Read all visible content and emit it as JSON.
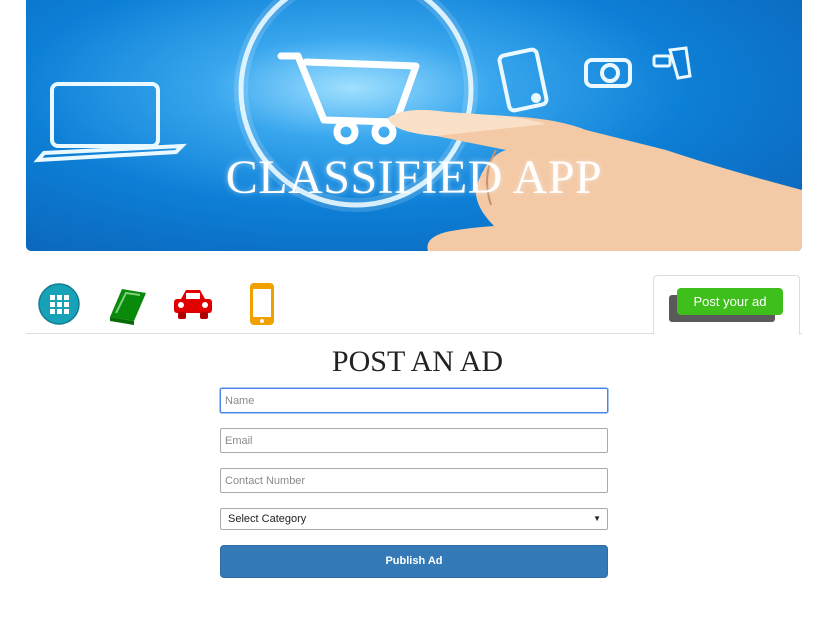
{
  "banner": {
    "title": "CLASSIFIED APP"
  },
  "nav": {
    "icons": [
      {
        "name": "grid-icon",
        "color": "#17a2b8"
      },
      {
        "name": "book-icon",
        "color": "#0a8a0a"
      },
      {
        "name": "car-icon",
        "color": "#e00000"
      },
      {
        "name": "mobile-icon",
        "color": "#f0a000"
      }
    ],
    "post_button_label": "Post your ad"
  },
  "form": {
    "title": "POST AN AD",
    "name_placeholder": "Name",
    "email_placeholder": "Email",
    "contact_placeholder": "Contact Number",
    "category_selected": "Select Category",
    "submit_label": "Publish Ad"
  },
  "colors": {
    "accent": "#337ab7",
    "post_green": "#3fbf1c"
  }
}
